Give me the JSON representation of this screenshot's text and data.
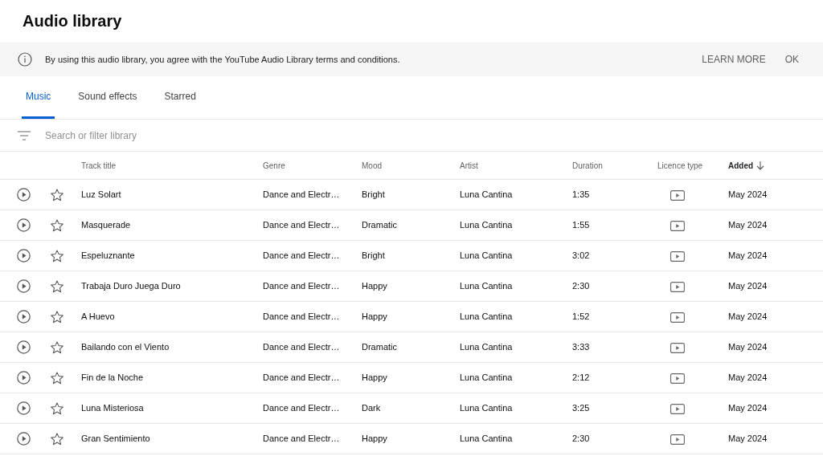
{
  "title": "Audio library",
  "notice": {
    "text": "By using this audio library, you agree with the YouTube Audio Library terms and conditions.",
    "actions": [
      "LEARN MORE",
      "OK"
    ]
  },
  "tabs": [
    {
      "label": "Music",
      "selected": true
    },
    {
      "label": "Sound effects",
      "selected": false
    },
    {
      "label": "Starred",
      "selected": false
    }
  ],
  "search": {
    "placeholder": "Search or filter library"
  },
  "table": {
    "columns": [
      {
        "label": "Track title",
        "sorted": false
      },
      {
        "label": "Genre",
        "sorted": false
      },
      {
        "label": "Mood",
        "sorted": false
      },
      {
        "label": "Artist",
        "sorted": false
      },
      {
        "label": "Duration",
        "sorted": false
      },
      {
        "label": "Licence type",
        "sorted": false
      },
      {
        "label": "Added",
        "sorted": true
      }
    ],
    "rows": [
      {
        "title": "Luz Solart",
        "genre": "Dance and Electr…",
        "mood": "Bright",
        "artist": "Luna Cantina",
        "duration": "1:35",
        "added": "May 2024",
        "starred": false
      },
      {
        "title": "Masquerade",
        "genre": "Dance and Electr…",
        "mood": "Dramatic",
        "artist": "Luna Cantina",
        "duration": "1:55",
        "added": "May 2024",
        "starred": false
      },
      {
        "title": "Espeluznante",
        "genre": "Dance and Electr…",
        "mood": "Bright",
        "artist": "Luna Cantina",
        "duration": "3:02",
        "added": "May 2024",
        "starred": false
      },
      {
        "title": "Trabaja Duro Juega Duro",
        "genre": "Dance and Electr…",
        "mood": "Happy",
        "artist": "Luna Cantina",
        "duration": "2:30",
        "added": "May 2024",
        "starred": false
      },
      {
        "title": "A Huevo",
        "genre": "Dance and Electr…",
        "mood": "Happy",
        "artist": "Luna Cantina",
        "duration": "1:52",
        "added": "May 2024",
        "starred": false
      },
      {
        "title": "Bailando con el Viento",
        "genre": "Dance and Electr…",
        "mood": "Dramatic",
        "artist": "Luna Cantina",
        "duration": "3:33",
        "added": "May 2024",
        "starred": false
      },
      {
        "title": "Fin de la Noche",
        "genre": "Dance and Electr…",
        "mood": "Happy",
        "artist": "Luna Cantina",
        "duration": "2:12",
        "added": "May 2024",
        "starred": false
      },
      {
        "title": "Luna Misteriosa",
        "genre": "Dance and Electr…",
        "mood": "Dark",
        "artist": "Luna Cantina",
        "duration": "3:25",
        "added": "May 2024",
        "starred": false
      },
      {
        "title": "Gran Sentimiento",
        "genre": "Dance and Electr…",
        "mood": "Happy",
        "artist": "Luna Cantina",
        "duration": "2:30",
        "added": "May 2024",
        "starred": false
      }
    ]
  }
}
